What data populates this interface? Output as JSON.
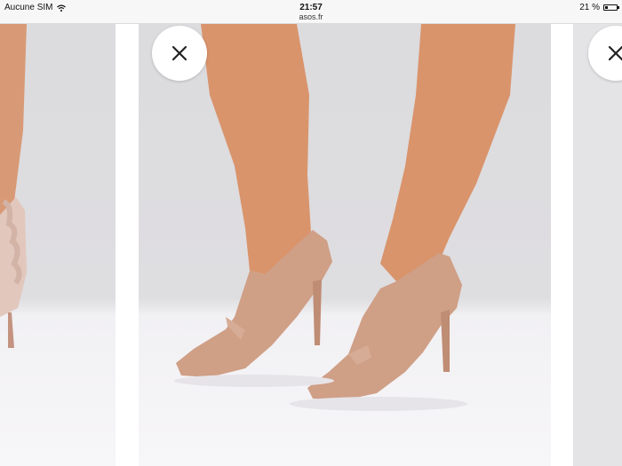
{
  "status_bar": {
    "carrier": "Aucune SIM",
    "time": "21:57",
    "url": "asos.fr",
    "battery_percent": "21 %",
    "battery_level": 0.21
  },
  "carousel": {
    "close_icon": "close-icon"
  }
}
